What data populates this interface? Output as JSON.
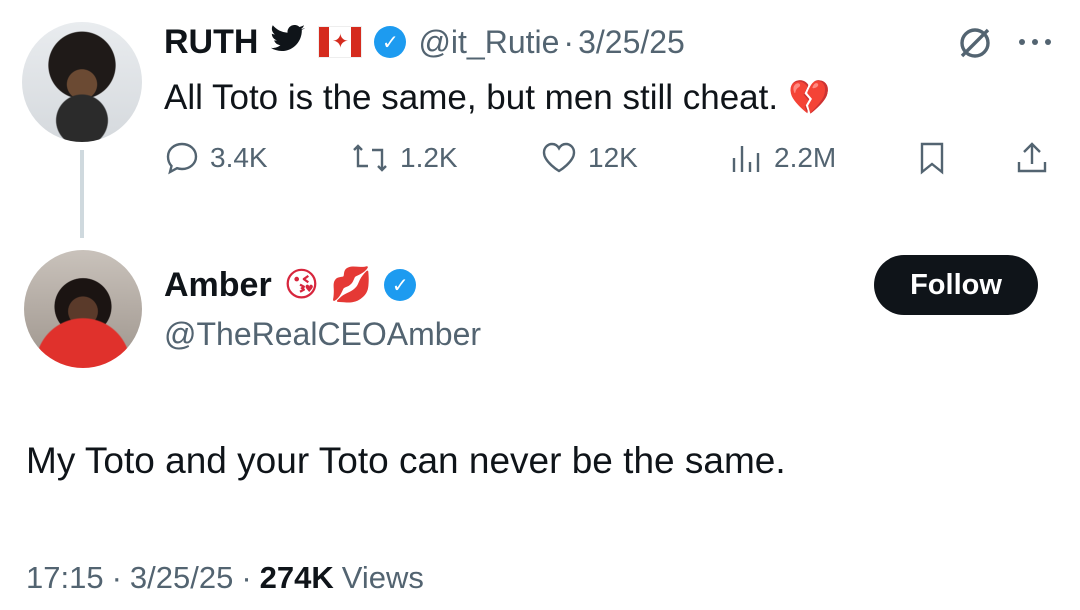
{
  "parent_tweet": {
    "author_name": "RUTH",
    "author_emoji": "🐦",
    "handle": "@it_Rutie",
    "separator": "·",
    "date": "3/25/25",
    "text": "All Toto is the same, but men still cheat.",
    "text_emoji": "💔",
    "replies": "3.4K",
    "reposts": "1.2K",
    "likes": "12K",
    "views": "2.2M"
  },
  "reply_tweet": {
    "author_name": "Amber",
    "author_emojis": "😘 💋",
    "handle": "@TheRealCEOAmber",
    "follow_label": "Follow",
    "text": "My Toto and your Toto can never be the same.",
    "time": "17:15",
    "date": "3/25/25",
    "views_count": "274K",
    "views_label": "Views"
  },
  "colors": {
    "text": "#0f1419",
    "secondary": "#536471",
    "verified": "#1d9bf0",
    "follow_bg": "#0f1419"
  },
  "icons": [
    "avatar",
    "bird-icon",
    "canada-flag-icon",
    "verified-icon",
    "grok-icon",
    "more-icon",
    "reply-icon",
    "repost-icon",
    "like-icon",
    "views-icon",
    "bookmark-icon",
    "share-icon"
  ]
}
